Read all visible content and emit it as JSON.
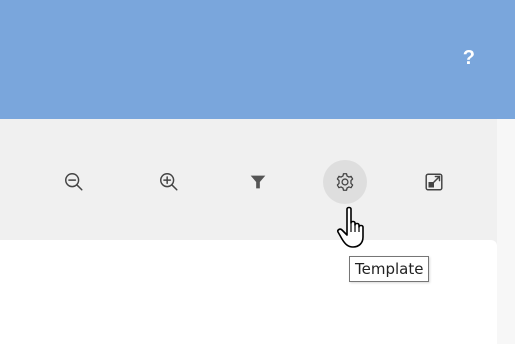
{
  "header": {
    "help_label": "?",
    "color": "#7aa6dc"
  },
  "toolbar": {
    "buttons": [
      {
        "icon": "zoom-out-icon"
      },
      {
        "icon": "zoom-in-icon"
      },
      {
        "icon": "filter-icon"
      },
      {
        "icon": "gear-icon",
        "state": "hovered"
      },
      {
        "icon": "expand-icon"
      }
    ]
  },
  "tooltip": {
    "text": "Template"
  },
  "cursor": {
    "icon": "hand-pointer-icon"
  }
}
